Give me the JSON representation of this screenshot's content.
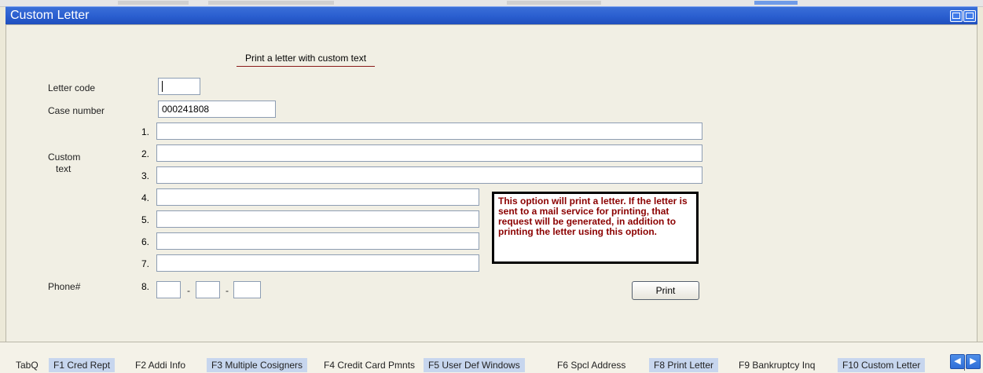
{
  "window": {
    "title": "Custom Letter"
  },
  "form": {
    "heading": "Print a letter with custom text",
    "letter_code_label": "Letter code",
    "letter_code_value": "",
    "case_number_label": "Case number",
    "case_number_value": "000241808",
    "custom_text_label_1": "Custom",
    "custom_text_label_2": "text",
    "phone_label": "Phone#",
    "line_numbers": [
      "1.",
      "2.",
      "3.",
      "4.",
      "5.",
      "6.",
      "7.",
      "8."
    ],
    "custom_lines": [
      "",
      "",
      "",
      "",
      "",
      "",
      ""
    ],
    "phone": {
      "area": "",
      "prefix": "",
      "suffix": ""
    },
    "phone_separator": "-",
    "note": "This option will print a letter. If the letter is sent to a mail service for printing, that request will be generated, in addition to printing the letter using this option.",
    "print_label": "Print"
  },
  "taskbar": {
    "tabs": [
      "TabQ",
      "F1 Cred Rept",
      "F2 Addi Info",
      "F3 Multiple Cosigners",
      "F4 Credit Card Pmnts",
      "F5 User Def Windows",
      "F6  Spcl Address",
      "F8 Print Letter",
      "F9 Bankruptcy Inq",
      "F10 Custom Letter"
    ]
  },
  "colors": {
    "title_bar": "#2a5ecf",
    "note_text": "#8b0000",
    "tab_highlight": "#c7d6ee"
  }
}
